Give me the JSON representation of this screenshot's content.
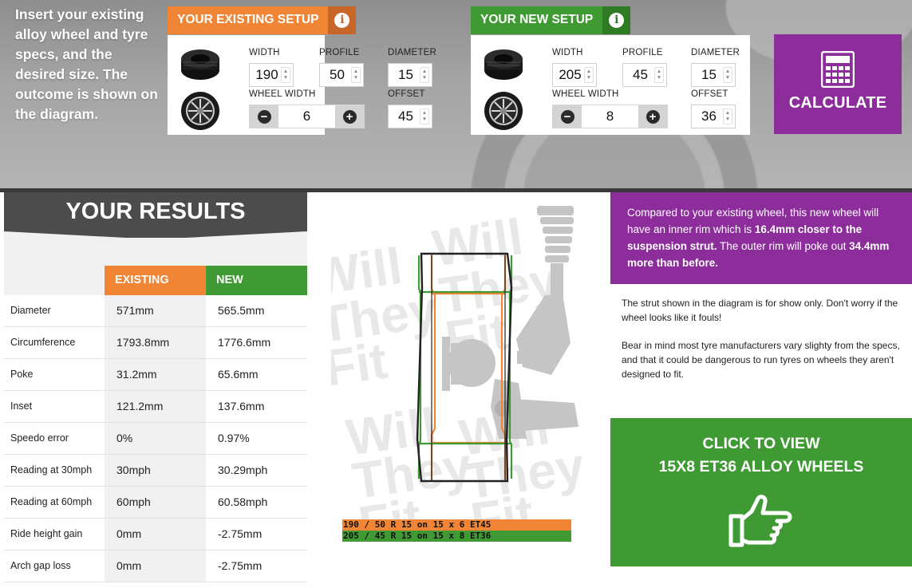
{
  "intro": {
    "text": "Insert your existing alloy wheel and tyre specs, and the desired size. The outcome is shown on the diagram."
  },
  "existing_setup": {
    "title": "YOUR EXISTING SETUP",
    "info_icon": "info-icon",
    "color": "#f08536",
    "width_label": "WIDTH",
    "width": "190",
    "profile_label": "PROFILE",
    "profile": "50",
    "diameter_label": "DIAMETER",
    "diameter": "15",
    "wheel_width_label": "WHEEL WIDTH",
    "wheel_width": "6",
    "offset_label": "OFFSET",
    "offset": "45"
  },
  "new_setup": {
    "title": "YOUR NEW SETUP",
    "info_icon": "info-icon",
    "color": "#3f9a33",
    "width_label": "WIDTH",
    "width": "205",
    "profile_label": "PROFILE",
    "profile": "45",
    "diameter_label": "DIAMETER",
    "diameter": "15",
    "wheel_width_label": "WHEEL WIDTH",
    "wheel_width": "8",
    "offset_label": "OFFSET",
    "offset": "36"
  },
  "calculate": {
    "label": "CALCULATE",
    "icon": "calculator-icon",
    "color": "#8c2d9b"
  },
  "results": {
    "title": "YOUR RESULTS",
    "col_existing": "EXISTING",
    "col_new": "NEW",
    "rows": [
      {
        "label": "Diameter",
        "existing": "571mm",
        "new": "565.5mm"
      },
      {
        "label": "Circumference",
        "existing": "1793.8mm",
        "new": "1776.6mm"
      },
      {
        "label": "Poke",
        "existing": "31.2mm",
        "new": "65.6mm"
      },
      {
        "label": "Inset",
        "existing": "121.2mm",
        "new": "137.6mm"
      },
      {
        "label": "Speedo error",
        "existing": "0%",
        "new": "0.97%"
      },
      {
        "label": "Reading at 30mph",
        "existing": "30mph",
        "new": "30.29mph"
      },
      {
        "label": "Reading at 60mph",
        "existing": "60mph",
        "new": "60.58mph"
      },
      {
        "label": "Ride height gain",
        "existing": "0mm",
        "new": "-2.75mm"
      },
      {
        "label": "Arch gap loss",
        "existing": "0mm",
        "new": "-2.75mm"
      }
    ]
  },
  "diagram": {
    "watermark": "Will They Fit .com",
    "legend_existing": "190 / 50 R 15 on 15 x 6 ET45",
    "legend_new": "205 / 45 R 15 on 15 x 8 ET36"
  },
  "comparison": {
    "part1": "Compared to your existing wheel, this new wheel will have an inner rim which is ",
    "bold1": "16.4mm closer to the suspension strut.",
    "part2": " The outer rim will poke out ",
    "bold2": "34.4mm more than before."
  },
  "notes": {
    "strut": "The strut shown in the diagram is for show only. Don't worry if the wheel looks like it fouls!",
    "manufacturers": "Bear in mind most tyre manufacturers vary slighty from the specs, and that it could be dangerous to run tyres on wheels they aren't designed to fit."
  },
  "cta": {
    "line1": "CLICK TO VIEW",
    "line2": "15X8 ET36 ALLOY WHEELS",
    "icon": "pointing-hand-icon"
  }
}
